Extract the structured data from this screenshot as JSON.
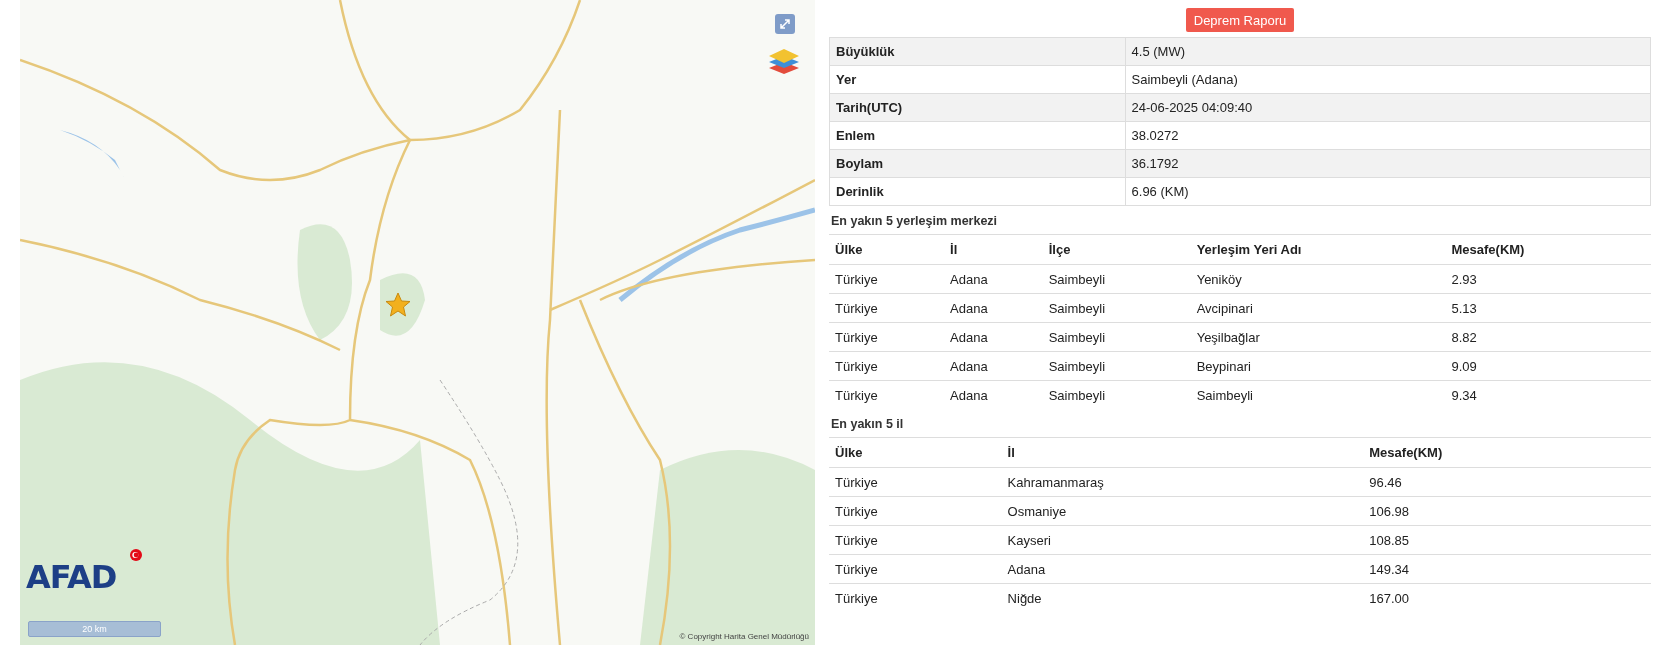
{
  "report_button": "Deprem Raporu",
  "map": {
    "logo": "AFAD",
    "scale": "20 km",
    "copyright": "© Copyright Harita Genel Müdürlüğü"
  },
  "details": [
    {
      "label": "Büyüklük",
      "value": "4.5 (MW)"
    },
    {
      "label": "Yer",
      "value": "Saimbeyli (Adana)"
    },
    {
      "label": "Tarih(UTC)",
      "value": "24-06-2025 04:09:40"
    },
    {
      "label": "Enlem",
      "value": "38.0272"
    },
    {
      "label": "Boylam",
      "value": "36.1792"
    },
    {
      "label": "Derinlik",
      "value": "6.96 (KM)"
    }
  ],
  "settlements": {
    "title": "En yakın 5 yerleşim merkezi",
    "columns": [
      "Ülke",
      "İl",
      "İlçe",
      "Yerleşim Yeri Adı",
      "Mesafe(KM)"
    ],
    "rows": [
      [
        "Türkiye",
        "Adana",
        "Saimbeyli",
        "Yeniköy",
        "2.93"
      ],
      [
        "Türkiye",
        "Adana",
        "Saimbeyli",
        "Avcipinari",
        "5.13"
      ],
      [
        "Türkiye",
        "Adana",
        "Saimbeyli",
        "Yeşilbağlar",
        "8.82"
      ],
      [
        "Türkiye",
        "Adana",
        "Saimbeyli",
        "Beypinari",
        "9.09"
      ],
      [
        "Türkiye",
        "Adana",
        "Saimbeyli",
        "Saimbeyli",
        "9.34"
      ]
    ]
  },
  "provinces": {
    "title": "En yakın 5 il",
    "columns": [
      "Ülke",
      "İl",
      "Mesafe(KM)"
    ],
    "rows": [
      [
        "Türkiye",
        "Kahramanmaraş",
        "96.46"
      ],
      [
        "Türkiye",
        "Osmaniye",
        "106.98"
      ],
      [
        "Türkiye",
        "Kayseri",
        "108.85"
      ],
      [
        "Türkiye",
        "Adana",
        "149.34"
      ],
      [
        "Türkiye",
        "Niğde",
        "167.00"
      ]
    ]
  }
}
